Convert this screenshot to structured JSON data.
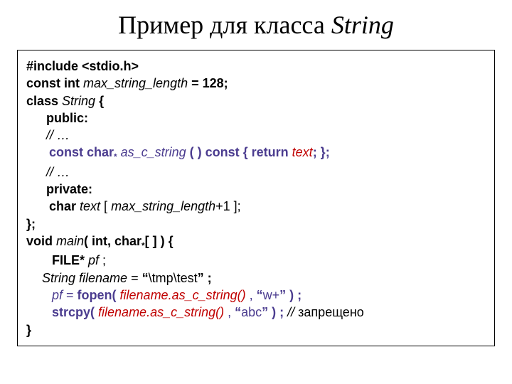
{
  "title": {
    "prefix": "Пример для класса ",
    "class_name": "String"
  },
  "code": {
    "l1_include": "#include ",
    "l1_header": "<stdio.h>",
    "l2_const_int": "const int ",
    "l2_name": "max_string_length",
    "l2_tail": " = 128;",
    "l3_class": "class ",
    "l3_name": "String",
    "l3_brace": " {",
    "l4_public": "public:",
    "l5_ellipsis": " // …",
    "l6_cc": "const char",
    "l6_star": "*",
    "l6_fn": " as_c_string",
    "l6_mid": " ( ) const { return ",
    "l6_text": "text",
    "l6_tail": "; };",
    "l7_ellipsis": " // …",
    "l8_private": "private:",
    "l9_char": "char ",
    "l9_text": "text",
    "l9_open": " [ ",
    "l9_name": "max_string_length",
    "l9_tail": "+1 ];",
    "l10_close": "};",
    "l11_void": "void ",
    "l11_main": "main",
    "l11_paren": "( int, char",
    "l11_star": "*",
    "l11_tail": "[ ] ) {",
    "l12_file": "FILE* ",
    "l12_pf": "pf",
    "l12_tail": " ;",
    "l13_string": "String filename",
    "l13_eq": " = ",
    "l13_q1": "“",
    "l13_path": "\\tmp\\test",
    "l13_q2": "” ;",
    "l14_pf": "pf",
    "l14_eq": " = ",
    "l14_fopen": "fopen( ",
    "l14_arg": "filename.as_c_string()",
    "l14_comma": " , ",
    "l14_q1": "“",
    "l14_mode": "w+",
    "l14_q2": "” ) ;",
    "l15_strcpy": "strcpy( ",
    "l15_arg": "filename.as_c_string()",
    "l15_comma": " , ",
    "l15_q1": "“",
    "l15_abc": "abc",
    "l15_q2": "” ) ;",
    "l15_comment_slash": "   // ",
    "l15_comment_text": "  запрещено",
    "l16_close": "}"
  }
}
